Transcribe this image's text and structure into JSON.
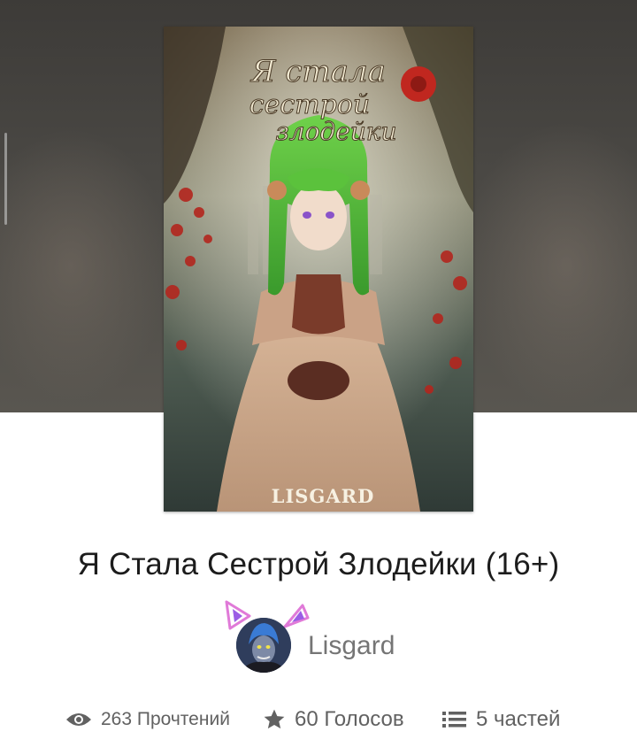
{
  "cover": {
    "title_line1": "Я стала",
    "title_line2": "сестрой",
    "title_line3": "злодейки",
    "author_mark": "LISGARD"
  },
  "story": {
    "title": "Я Стала Сестрой Злодейки (16+)"
  },
  "author": {
    "name": "Lisgard"
  },
  "stats": {
    "reads_label": "263 Прочтений",
    "votes_label": "60 Голосов",
    "parts_label": "5 частей"
  },
  "icons": {
    "reads": "eye-icon",
    "votes": "star-icon",
    "parts": "list-icon"
  },
  "colors": {
    "text_primary": "#1c1c1c",
    "text_secondary": "#616161",
    "author_name": "#757575",
    "hair_green": "#4fbf3a",
    "accent_red": "#c0271f",
    "avatar_ears": "#e07ad8"
  }
}
